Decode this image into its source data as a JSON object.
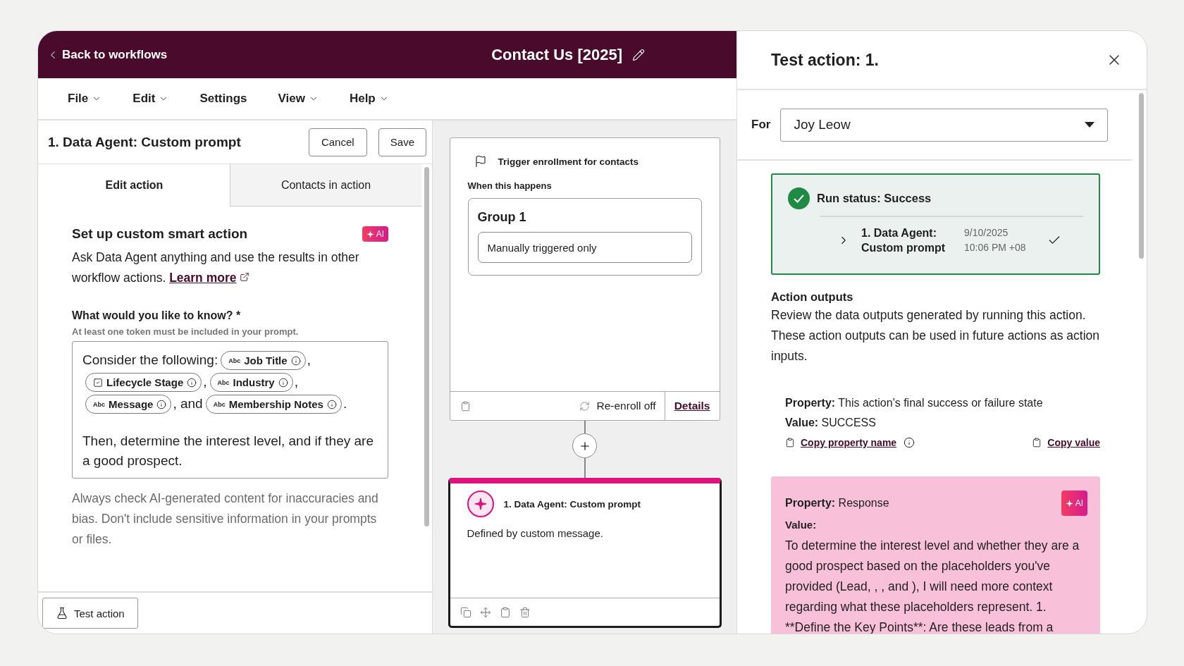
{
  "header": {
    "back_label": "Back to workflows",
    "title": "Contact Us [2025]"
  },
  "menu": [
    {
      "label": "File",
      "has_dropdown": true
    },
    {
      "label": "Edit",
      "has_dropdown": true
    },
    {
      "label": "Settings",
      "has_dropdown": false
    },
    {
      "label": "View",
      "has_dropdown": true
    },
    {
      "label": "Help",
      "has_dropdown": true
    }
  ],
  "editor": {
    "title": "1. Data Agent: Custom prompt",
    "buttons": [
      "Cancel",
      "Save"
    ],
    "tabs": [
      {
        "label": "Edit action",
        "selected": true
      },
      {
        "label": "Contacts in action",
        "selected": false
      }
    ],
    "section_title": "Set up custom smart action",
    "ai_badge": "AI",
    "description": "Ask Data Agent anything and use the results in other workflow actions.",
    "learn_more": "Learn more",
    "question_label": "What would you like to know? *",
    "question_hint": "At least one token must be included in your prompt.",
    "prompt": [
      {
        "kind": "text",
        "text": "Consider the following:"
      },
      {
        "kind": "text_token",
        "label": "Job Title",
        "type_badge": "Abc"
      },
      {
        "kind": "text",
        "text": ","
      },
      {
        "kind": "select_token",
        "label": "Lifecycle Stage"
      },
      {
        "kind": "text",
        "text": ","
      },
      {
        "kind": "text_token",
        "label": "Industry",
        "type_badge": "Abc"
      },
      {
        "kind": "text",
        "text": ","
      },
      {
        "kind": "text_token",
        "label": "Message",
        "type_badge": "Abc"
      },
      {
        "kind": "text",
        "text": ", and"
      },
      {
        "kind": "text_token",
        "label": "Membership Notes",
        "type_badge": "Abc"
      },
      {
        "kind": "text",
        "text": "."
      }
    ],
    "prompt_second": "Then, determine the interest level, and if they are a good prospect.",
    "disclaimer": "Always check AI-generated content for inaccuracies and bias. Don't include sensitive information in your prompts or files.",
    "test_button": "Test action"
  },
  "canvas": {
    "trigger": {
      "title": "Trigger enrollment for contacts",
      "subtitle": "When this happens",
      "group_title": "Group 1",
      "condition": "Manually triggered only",
      "reenroll": "Re-enroll off",
      "details": "Details"
    },
    "action": {
      "title": "1. Data Agent: Custom prompt",
      "description": "Defined by custom message.",
      "selected": true
    }
  },
  "test_panel": {
    "title": "Test action: 1.",
    "for_label": "For",
    "contact": "Joy Leow",
    "success": true,
    "run_status": "Run status: Success",
    "step_name": "1. Data Agent: Custom prompt",
    "step_date": "9/10/2025",
    "step_time": "10:06 PM +08",
    "outputs_title": "Action outputs",
    "outputs_description": "Review the data outputs generated by running this action. These action outputs can be used in future actions as action inputs.",
    "outputs": [
      {
        "kind": "plain",
        "property": "**Property:** This action's final success or failure state",
        "value": "**Value:** SUCCESS",
        "copy_name": "Copy property name",
        "copy_value": "Copy value"
      },
      {
        "kind": "ai",
        "property": "**Property:** Response",
        "ai_badge": "AI",
        "value_label": "Value:",
        "value": "To determine the interest level and whether they are a good prospect based on the placeholders you've provided (Lead, , , and ), I will need more context regarding what these placeholders represent. 1. **Define the Key Points**: Are these leads from a"
      }
    ]
  }
}
